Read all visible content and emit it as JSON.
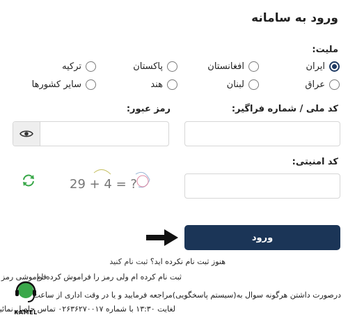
{
  "page": {
    "title": "ورود به سامانه"
  },
  "nationality": {
    "label": "ملیت:",
    "options": [
      {
        "label": "ایران",
        "checked": true
      },
      {
        "label": "افغانستان",
        "checked": false
      },
      {
        "label": "پاکستان",
        "checked": false
      },
      {
        "label": "ترکیه",
        "checked": false
      },
      {
        "label": "عراق",
        "checked": false
      },
      {
        "label": "لبنان",
        "checked": false
      },
      {
        "label": "هند",
        "checked": false
      },
      {
        "label": "سایر کشورها",
        "checked": false
      }
    ]
  },
  "form": {
    "national_id_label": "کد ملی / شماره فراگیر:",
    "password_label": "رمز عبور:",
    "security_code_label": "کد امنیتی:",
    "captcha_text": "29 + 4 = ?",
    "login_button": "ورود"
  },
  "links": {
    "not_registered": "هنوز ثبت نام نکرده اید؟",
    "register": "ثبت نام کنید",
    "registered_forgot": "ثبت نام کرده ام ولی رمز را فراموش کرده ام",
    "forgot_password": "فراموشی رمز عبور"
  },
  "help": {
    "line1": "درصورت داشتن هرگونه سوال به(سیستم پاسخگویی)مراجعه فرمایید و یا در وقت اداری از ساعت",
    "line2": "لغایت ۱۳:۳۰ با شماره ۰۲۶۳۶۲۷۰۰۱۷ تماس حاصل نمائید ."
  },
  "logo": {
    "text": "KAMEL"
  },
  "colors": {
    "primary": "#1b3557",
    "accent_green": "#3aa84a"
  }
}
